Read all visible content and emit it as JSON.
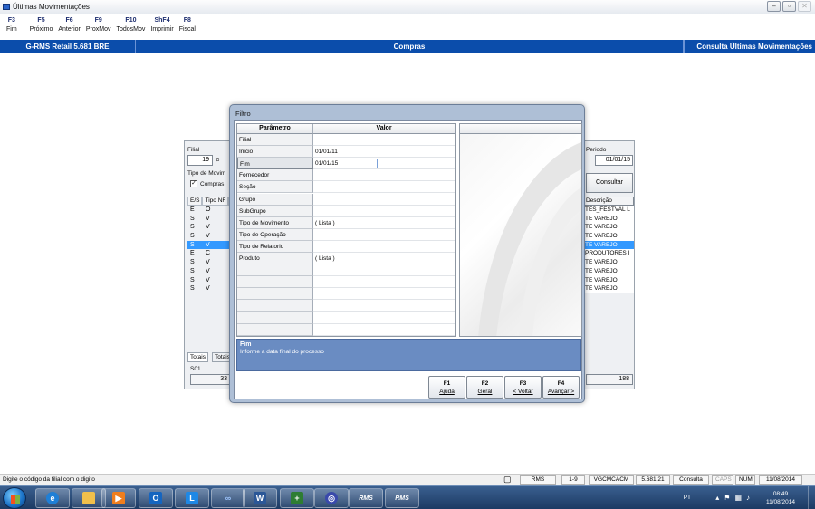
{
  "window": {
    "title": "Últimas Movimentações"
  },
  "fkeys": [
    {
      "key": "F3",
      "label": "Fim"
    },
    {
      "key": "F5",
      "label": "Próximo"
    },
    {
      "key": "F6",
      "label": "Anterior"
    },
    {
      "key": "F9",
      "label": "ProxMov"
    },
    {
      "key": "F10",
      "label": "TodosMov"
    },
    {
      "key": "ShF4",
      "label": "Imprimir"
    },
    {
      "key": "F8",
      "label": "Fiscal"
    }
  ],
  "header": {
    "system": "G-RMS Retail 5.681 BRE",
    "module": "Compras",
    "screen": "Consulta Últimas Movimentações"
  },
  "background_form": {
    "filial_label": "Filial",
    "filial_value": "19",
    "periodo_label": "Periodo",
    "periodo_value": "01/01/15",
    "tipo_mov_label": "Tipo de Movim",
    "compras_label": "Compras",
    "columns": [
      "E/S",
      "Tipo NF",
      "N"
    ],
    "desc_header": "Descrição",
    "rows": [
      {
        "es": "E",
        "tipo": "O",
        "desc": "TES_FESTVAL L"
      },
      {
        "es": "S",
        "tipo": "V",
        "desc": "TE VAREJO"
      },
      {
        "es": "S",
        "tipo": "V",
        "desc": "TE VAREJO"
      },
      {
        "es": "S",
        "tipo": "V",
        "desc": "TE VAREJO"
      },
      {
        "es": "S",
        "tipo": "V",
        "desc": "TE VAREJO"
      },
      {
        "es": "E",
        "tipo": "C",
        "desc": "PRODUTORES I"
      },
      {
        "es": "S",
        "tipo": "V",
        "desc": "TE VAREJO"
      },
      {
        "es": "S",
        "tipo": "V",
        "desc": "TE VAREJO"
      },
      {
        "es": "S",
        "tipo": "V",
        "desc": "TE VAREJO"
      },
      {
        "es": "S",
        "tipo": "V",
        "desc": "TE VAREJO"
      }
    ],
    "consultar_label": "Consultar",
    "tab_totais": "Totais",
    "tab_totais2": "Totais",
    "s01_label": "S01",
    "total_left": "33",
    "total_right": "188"
  },
  "dialog": {
    "title": "Filtro",
    "col_param": "Parâmetro",
    "col_valor": "Valor",
    "rows": [
      {
        "param": "Filial",
        "value": ""
      },
      {
        "param": "Inicio",
        "value": "01/01/11"
      },
      {
        "param": "Fim",
        "value": "01/01/15"
      },
      {
        "param": "Fornecedor",
        "value": ""
      },
      {
        "param": "Seção",
        "value": ""
      },
      {
        "param": "Grupo",
        "value": ""
      },
      {
        "param": "SubGrupo",
        "value": ""
      },
      {
        "param": "Tipo de Movimento",
        "value": "( Lista )"
      },
      {
        "param": "Tipo de Operação",
        "value": ""
      },
      {
        "param": "Tipo de Relatorio",
        "value": ""
      },
      {
        "param": "Produto",
        "value": "( Lista )"
      },
      {
        "param": "",
        "value": ""
      },
      {
        "param": "",
        "value": ""
      },
      {
        "param": "",
        "value": ""
      },
      {
        "param": "",
        "value": ""
      },
      {
        "param": "",
        "value": ""
      },
      {
        "param": "",
        "value": ""
      }
    ],
    "active_row": 2,
    "help_title": "Fim",
    "help_text": "Informe a data final do processo",
    "buttons": [
      {
        "key": "F1",
        "label": "Ajuda"
      },
      {
        "key": "F2",
        "label": "Geral"
      },
      {
        "key": "F3",
        "label": "< Voltar"
      },
      {
        "key": "F4",
        "label": "Avançar >"
      }
    ]
  },
  "statusbar": {
    "message": "Digite o código da filial com o digito",
    "cells": [
      "RMS",
      "1-9",
      "VGCMCACM",
      "5.681.21",
      "Consulta",
      "CAPS",
      "NUM",
      "11/08/2014"
    ]
  },
  "taskbar": {
    "lang": "PT",
    "time": "08:49",
    "date": "11/08/2014",
    "rms_label": "RMS"
  },
  "colors": {
    "header_blue": "#0b4dab",
    "dialog_frame": "#aebfd6",
    "help_blue": "#6a8cc2",
    "selection": "#3399ff"
  }
}
